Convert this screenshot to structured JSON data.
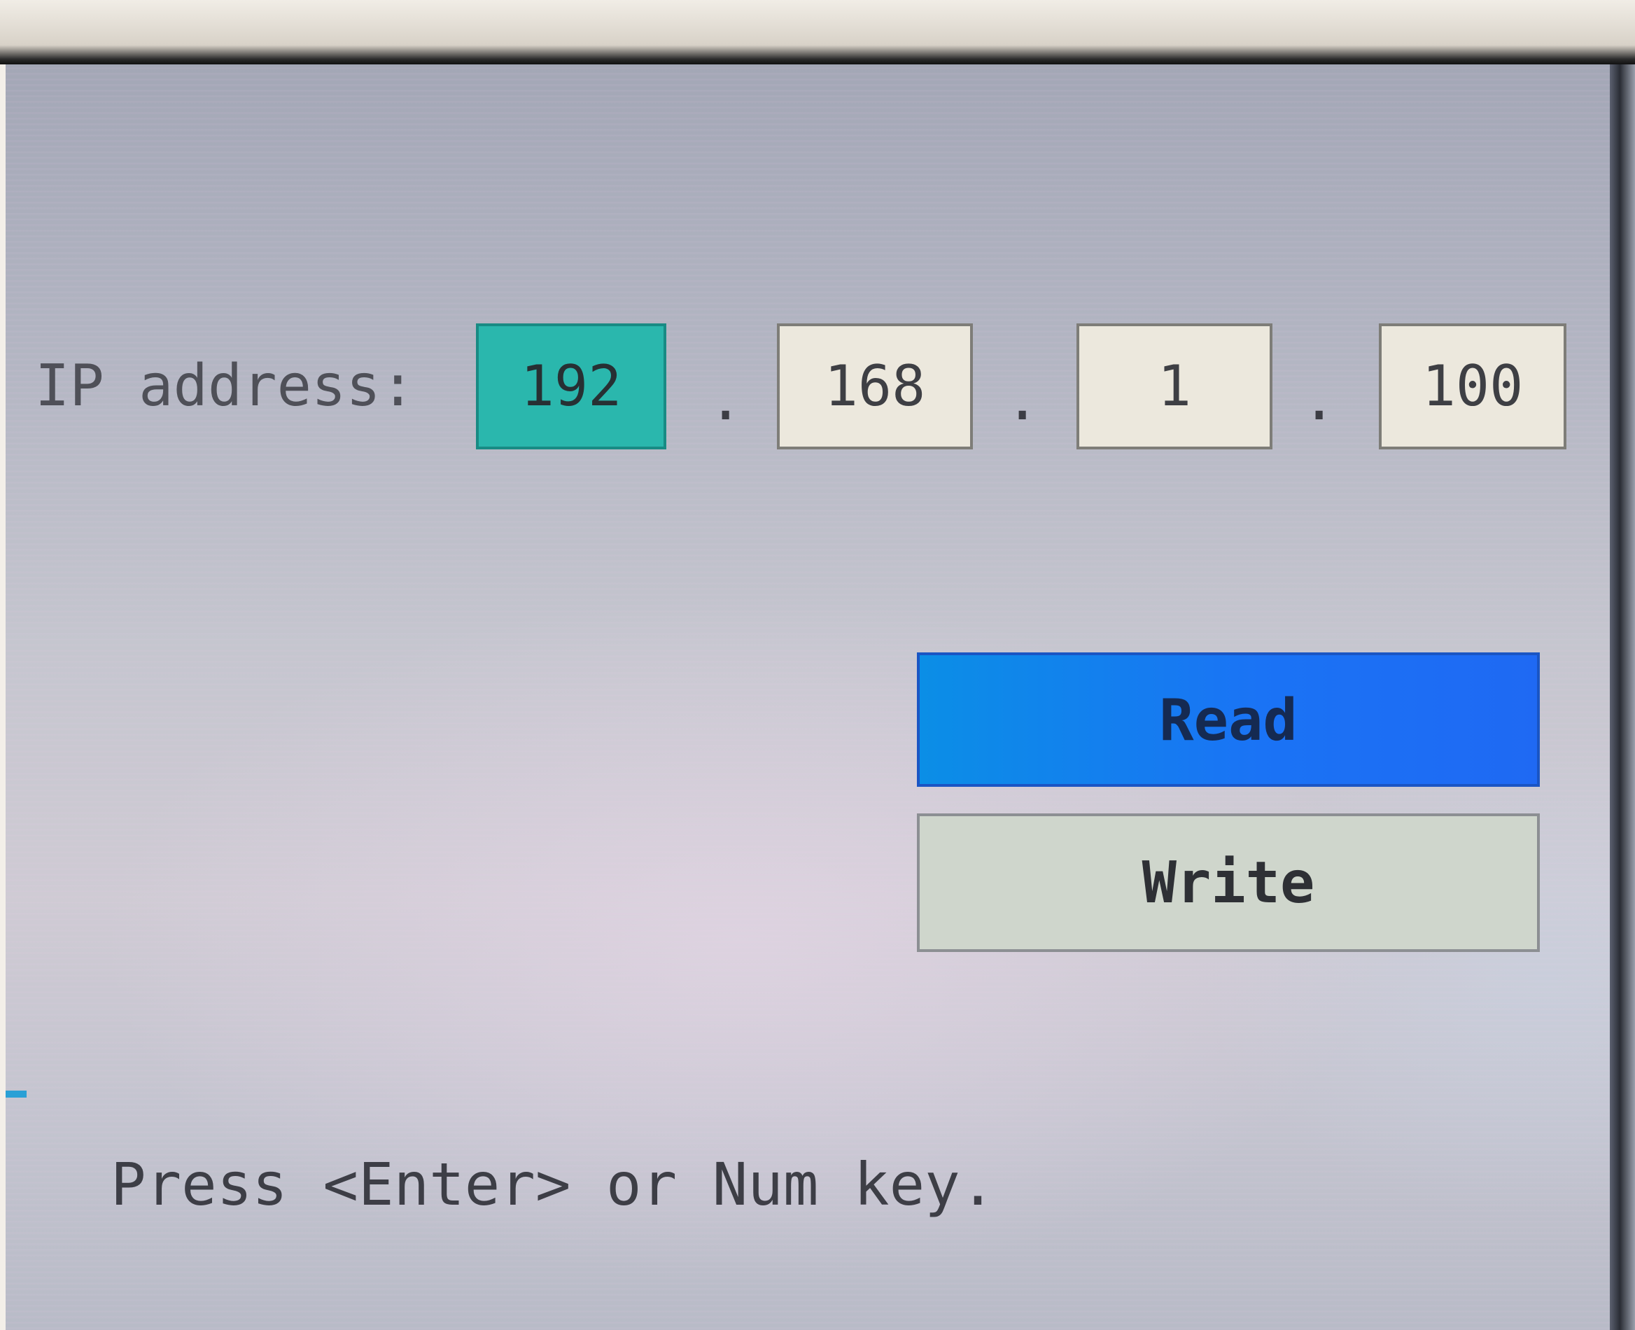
{
  "form": {
    "ip_label": "IP address:",
    "octets": [
      "192",
      "168",
      "1",
      "100"
    ],
    "separator": ".",
    "active_octet": "192",
    "buttons": {
      "read": "Read",
      "write": "Write"
    },
    "hint": "Press <Enter> or Num key."
  },
  "colors": {
    "active_field": "#2ab7ad",
    "read_button": "#1a73f5",
    "write_button": "#cfd6cc",
    "field_background": "#ece8dd"
  }
}
